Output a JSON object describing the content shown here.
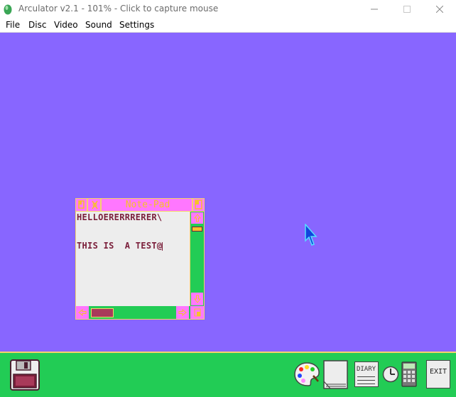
{
  "window": {
    "title": "Arculator v2.1 - 101% - Click to capture mouse"
  },
  "menu": {
    "items": [
      "File",
      "Disc",
      "Video",
      "Sound",
      "Settings"
    ]
  },
  "notepad": {
    "title": "Note-Pad",
    "lines": [
      "HELLOERERRRERER\\",
      "",
      "THIS IS  A TEST@"
    ]
  },
  "iconbar": {
    "diary_label": "DIARY",
    "exit_label": "EXIT"
  },
  "colors": {
    "desktop": "#8866ff",
    "iconbar": "#22cc55",
    "window_frame": "#f4d36a",
    "notepad_titlebar": "#ff77ff",
    "notepad_text": "#7a1e3a",
    "notepad_page": "#ededed"
  },
  "icons": [
    "app-logo-icon",
    "minimize-icon",
    "maximize-icon",
    "close-icon",
    "mouse-pointer-icon",
    "floppy-disk-icon",
    "palette-icon",
    "notepad-icon",
    "diary-icon",
    "clock-icon",
    "calculator-icon",
    "exit-icon"
  ]
}
